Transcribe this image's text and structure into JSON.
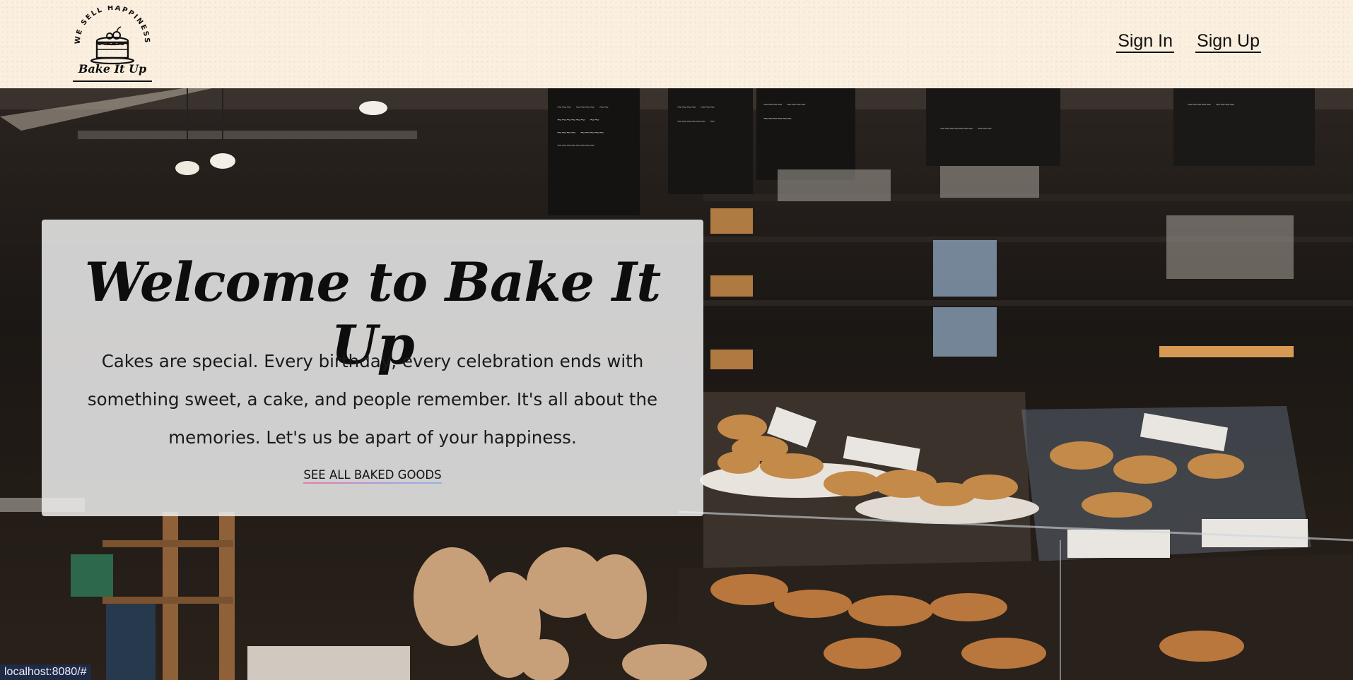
{
  "header": {
    "logo": {
      "tagline": "WE SELL HAPPINESS",
      "name": "Bake It Up"
    },
    "nav": [
      {
        "label": "Sign In"
      },
      {
        "label": "Sign Up"
      }
    ]
  },
  "hero": {
    "title": "Welcome to Bake It Up",
    "description": "Cakes are special. Every birthday, every celebration ends with something sweet, a cake, and people remember. It's all about the memories. Let's us be apart of your happiness.",
    "cta_label": "SEE ALL BAKED GOODS"
  },
  "statusbar": {
    "url": "localhost:8080/#"
  },
  "colors": {
    "header_bg": "#fbefdf",
    "card_bg": "#eeeeee",
    "text": "#111111",
    "link_underline_start": "#e97aa6",
    "link_underline_end": "#8fb7e8",
    "statusbar_bg": "#1f2a44"
  }
}
